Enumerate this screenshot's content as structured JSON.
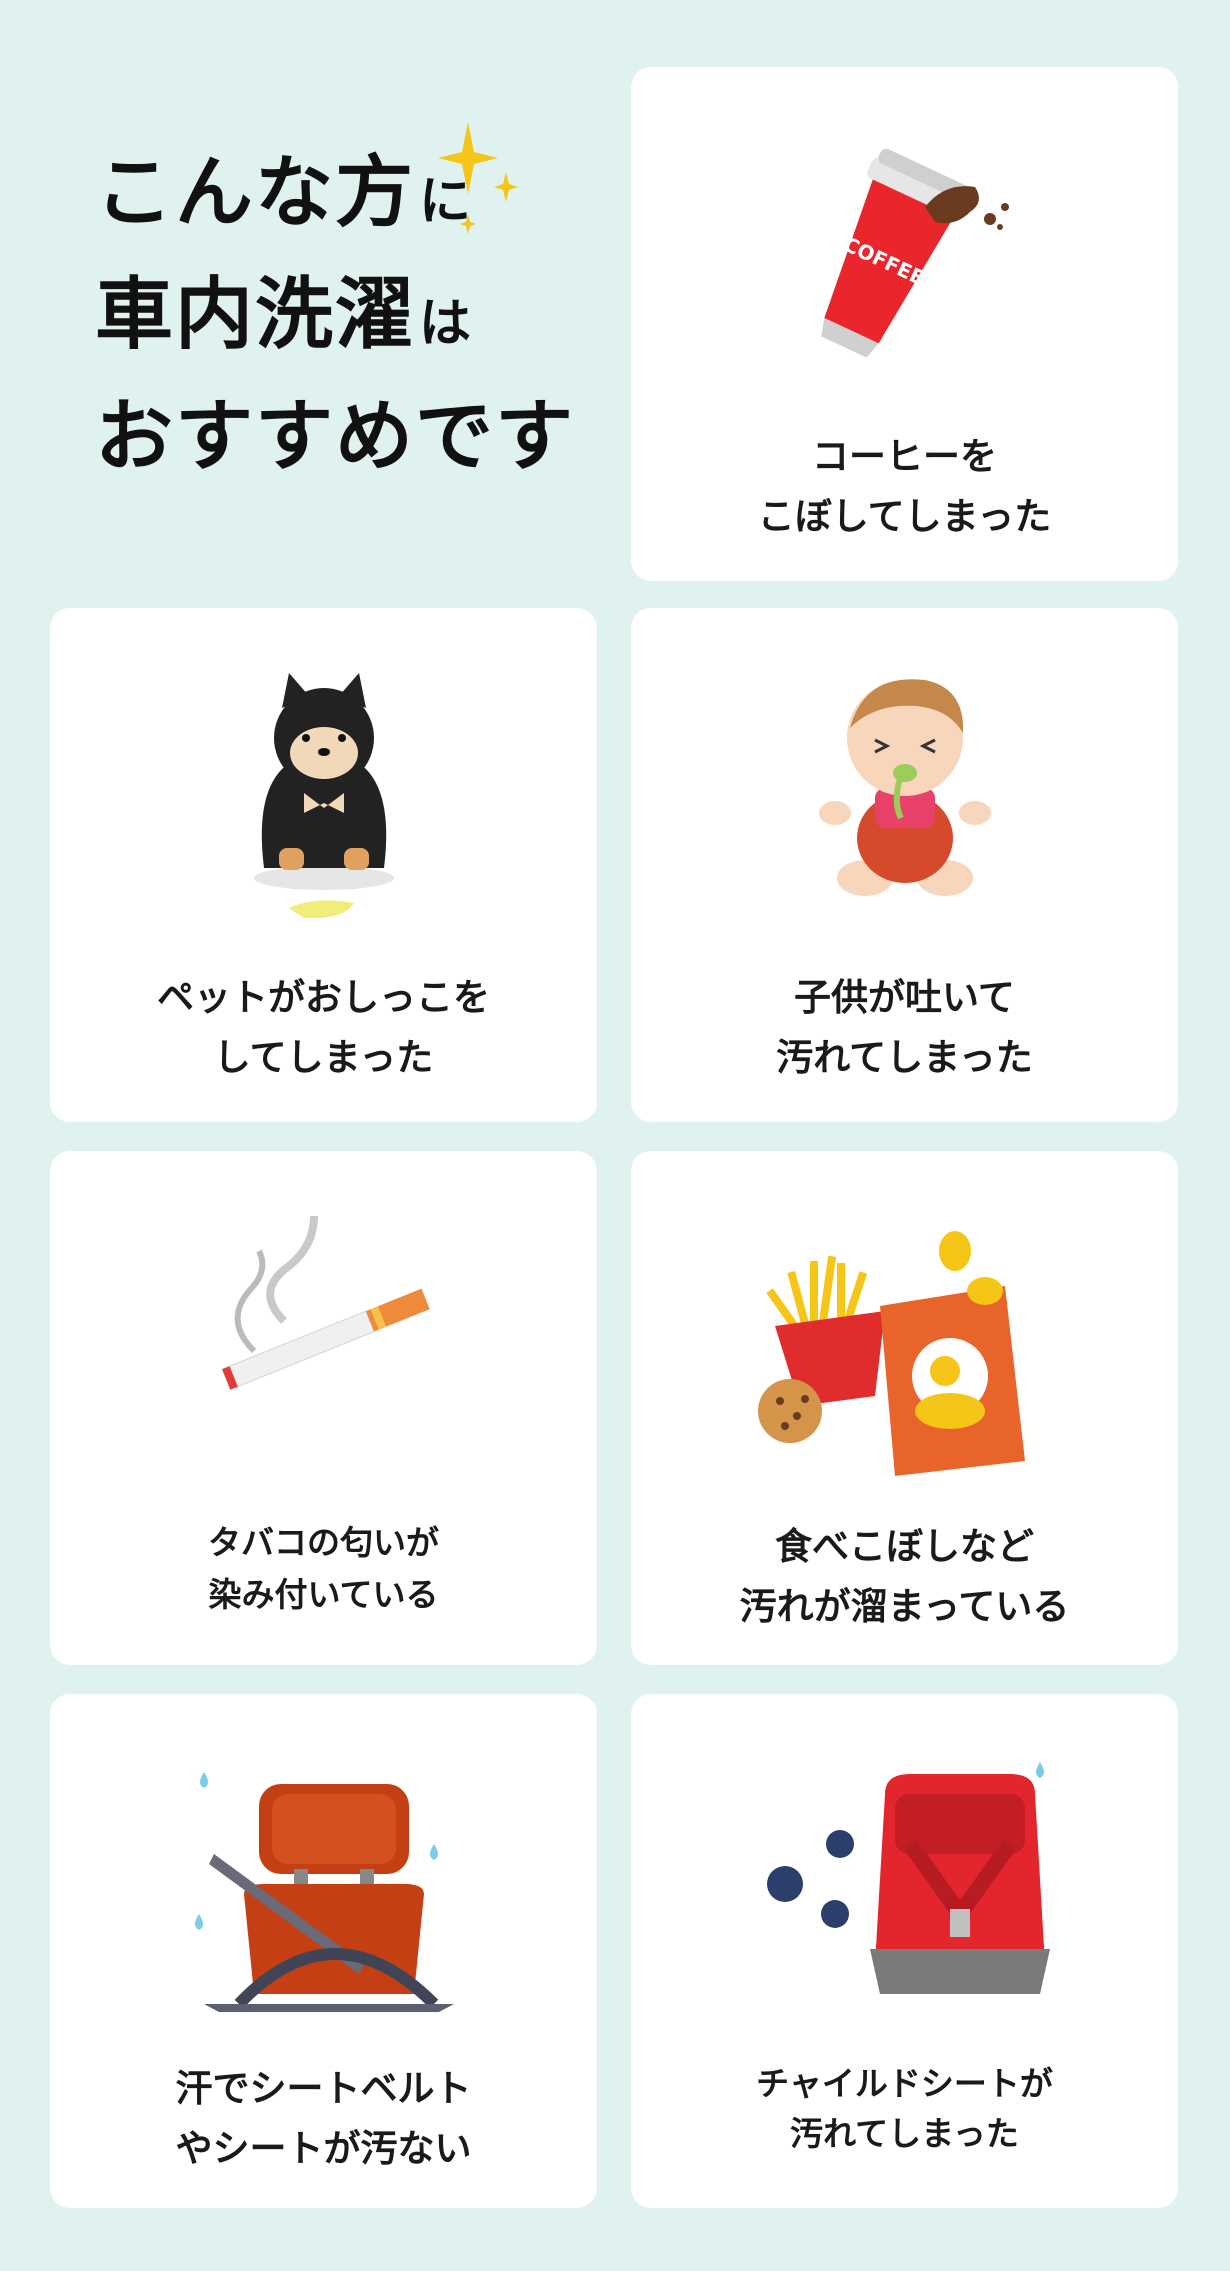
{
  "headline": {
    "line1": "こんな方",
    "line1_particle": "に",
    "line2": "車内洗濯",
    "line2_particle": "は",
    "line3": "おすすめです"
  },
  "coffee_label": "COFFEE",
  "cards": [
    {
      "line1": "コーヒーを",
      "line2": "こぼしてしまった",
      "icon": "coffee-spill-icon"
    },
    {
      "line1": "ペットがおしっこを",
      "line2": "してしまった",
      "icon": "pet-dog-icon"
    },
    {
      "line1": "子供が吐いて",
      "line2": "汚れてしまった",
      "icon": "baby-vomit-icon"
    },
    {
      "line1": "タバコの匂いが",
      "line2": "染み付いている",
      "icon": "cigarette-icon"
    },
    {
      "line1": "食べこぼしなど",
      "line2": "汚れが溜まっている",
      "icon": "snacks-icon"
    },
    {
      "line1": "汗でシートベルト",
      "line2": "やシートが汚ない",
      "icon": "car-seat-icon"
    },
    {
      "line1": "チャイルドシートが",
      "line2": "汚れてしまった",
      "icon": "child-seat-icon"
    }
  ],
  "colors": {
    "background": "#e0f2ef",
    "card": "#ffffff",
    "text": "#1a1a1a"
  }
}
